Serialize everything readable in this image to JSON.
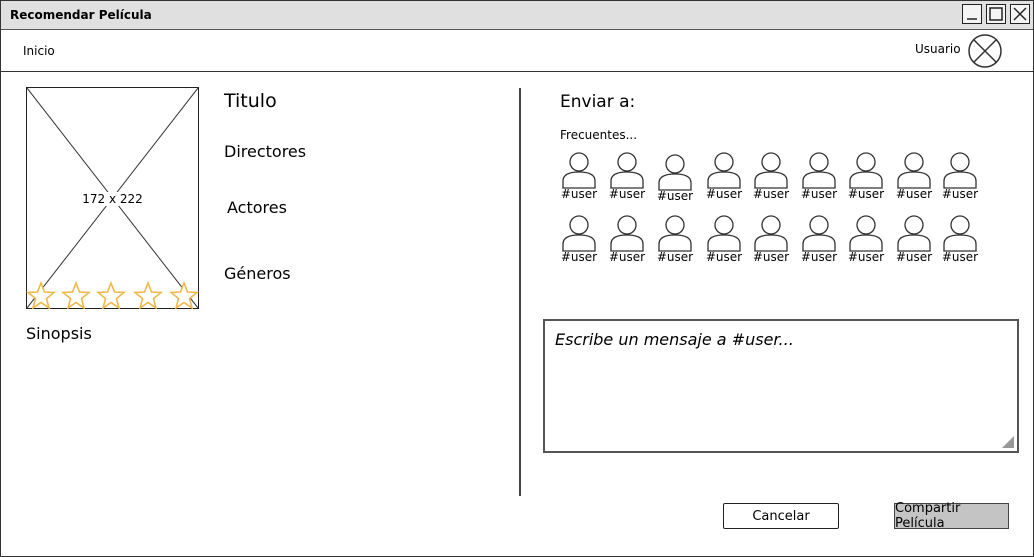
{
  "window": {
    "title": "Recomendar Película"
  },
  "nav": {
    "home": "Inicio",
    "user": "Usuario"
  },
  "movie": {
    "poster_placeholder": "172 x 222",
    "rating_stars": 5,
    "title": "Titulo",
    "directors": "Directores",
    "actors": "Actores",
    "genres": "Géneros",
    "synopsis": "Sinopsis"
  },
  "send": {
    "heading": "Enviar a:",
    "frequent_label": "Frecuentes...",
    "users": [
      "#user",
      "#user",
      "#user",
      "#user",
      "#user",
      "#user",
      "#user",
      "#user",
      "#user",
      "#user",
      "#user",
      "#user",
      "#user",
      "#user",
      "#user",
      "#user",
      "#user",
      "#user"
    ]
  },
  "message": {
    "value": "Escribe un mensaje a #user..."
  },
  "actions": {
    "cancel": "Cancelar",
    "share": "Compartir Película"
  },
  "colors": {
    "star": "#f0b84a",
    "titlebar": "#e0e0e0",
    "share_button": "#c4c4c4"
  }
}
